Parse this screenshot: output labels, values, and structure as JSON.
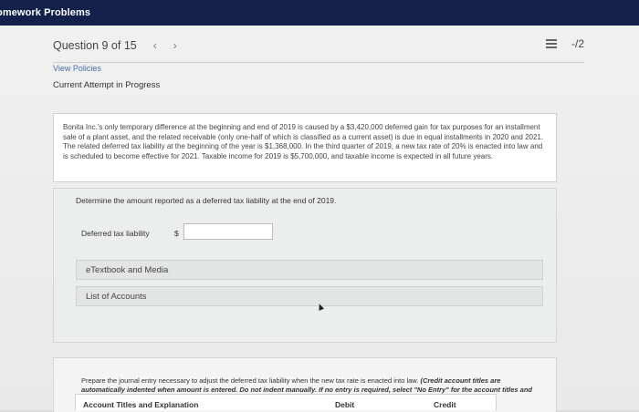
{
  "header": {
    "title": "omework Problems"
  },
  "question": {
    "label": "Question 9 of 15",
    "prev": "‹",
    "next": "›",
    "score": "-/2"
  },
  "links": {
    "policies": "View Policies"
  },
  "attempt_status": "Current Attempt in Progress",
  "problem_text": "Bonita Inc.'s only temporary difference at the beginning and end of 2019 is caused by a $3,420,000 deferred gain for tax purposes for an installment sale of a plant asset, and the related receivable (only one-half of which is classified as a current asset) is due in equal installments in 2020 and 2021. The related deferred tax liability at the beginning of the year is $1,368,000. In the third quarter of 2019, a new tax rate of 20% is enacted into law and is scheduled to become effective for 2021. Taxable income for 2019 is $5,700,000, and taxable income is expected in all future years.",
  "part1": {
    "instruction": "Determine the amount reported as a deferred tax liability at the end of 2019.",
    "field_label": "Deferred tax liability",
    "currency": "$",
    "value": ""
  },
  "resources": [
    "eTextbook and Media",
    "List of Accounts"
  ],
  "part2": {
    "instruction": "Prepare the journal entry necessary to adjust the deferred tax liability when the new tax rate is enacted into law.",
    "note": "(Credit account titles are automatically indented when amount is entered. Do not indent manually. If no entry is required, select \"No Entry\" for the account titles and enter 0 for the amounts.)"
  },
  "table": {
    "headers": [
      "Account Titles and Explanation",
      "Debit",
      "Credit"
    ]
  }
}
